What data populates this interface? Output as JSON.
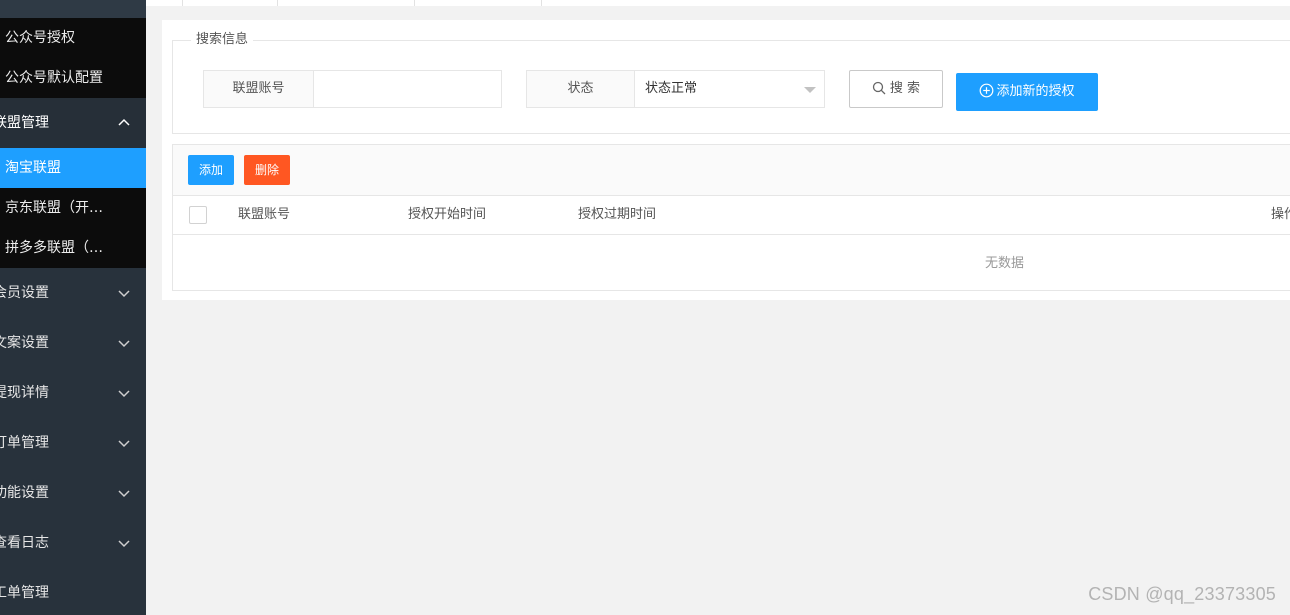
{
  "sidebar": {
    "sub_items_1": [
      {
        "label": "公众号授权"
      },
      {
        "label": "公众号默认配置"
      }
    ],
    "open_group": {
      "label": "联盟管理"
    },
    "sub_items_2": [
      {
        "label": "淘宝联盟",
        "active": true
      },
      {
        "label": "京东联盟（开…"
      },
      {
        "label": "拼多多联盟（…"
      }
    ],
    "groups": [
      {
        "label": "会员设置"
      },
      {
        "label": "文案设置"
      },
      {
        "label": "提现详情"
      },
      {
        "label": "订单管理"
      },
      {
        "label": "功能设置"
      },
      {
        "label": "查看日志"
      },
      {
        "label": "工单管理"
      }
    ]
  },
  "search": {
    "legend": "搜索信息",
    "account_label": "联盟账号",
    "account_value": "",
    "status_label": "状态",
    "status_value": "状态正常",
    "search_button": "搜 索",
    "add_auth_button": "添加新的授权"
  },
  "table": {
    "add_button": "添加",
    "delete_button": "删除",
    "columns": [
      "联盟账号",
      "授权开始时间",
      "授权过期时间",
      "操作"
    ],
    "empty_text": "无数据"
  },
  "watermark": "CSDN @qq_23373305",
  "colors": {
    "sidebar_bg": "#28323c",
    "active_blue": "#1e9fff",
    "danger_orange": "#ff5722"
  }
}
